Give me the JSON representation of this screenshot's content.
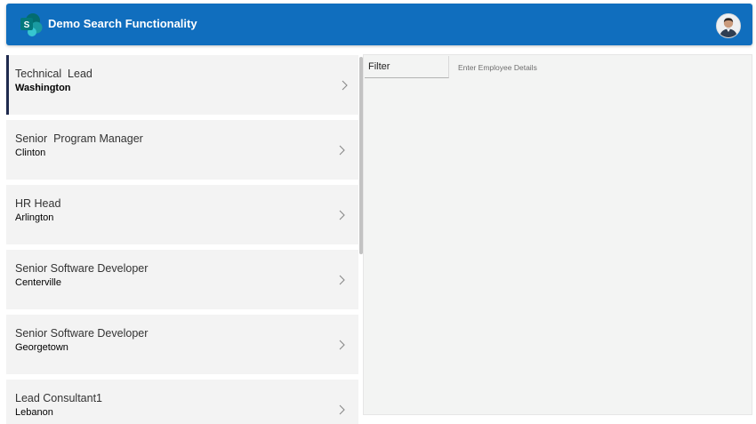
{
  "header": {
    "title": "Demo Search Functionality",
    "logo_icon": "sharepoint-logo-icon",
    "logo_letter": "S",
    "avatar_icon": "user-avatar-icon",
    "background_color": "#106ebe"
  },
  "list": {
    "items": [
      {
        "title": "Technical  Lead",
        "subtitle": "Washington",
        "selected": true
      },
      {
        "title": "Senior  Program Manager",
        "subtitle": "Clinton",
        "selected": false
      },
      {
        "title": "HR Head",
        "subtitle": "Arlington",
        "selected": false
      },
      {
        "title": "Senior Software Developer",
        "subtitle": "Centerville",
        "selected": false
      },
      {
        "title": "Senior Software Developer",
        "subtitle": "Georgetown",
        "selected": false
      },
      {
        "title": "Lead Consultant1",
        "subtitle": "Lebanon",
        "selected": false
      }
    ],
    "chevron_icon": "chevron-right-icon",
    "selected_accent_color": "#1f2a4e",
    "item_background_color": "#f3f3f3"
  },
  "detail": {
    "filter_label": "Filter",
    "employee_input_placeholder": "Enter Employee Details",
    "employee_input_value": "",
    "background_color": "#f3f4f3"
  }
}
